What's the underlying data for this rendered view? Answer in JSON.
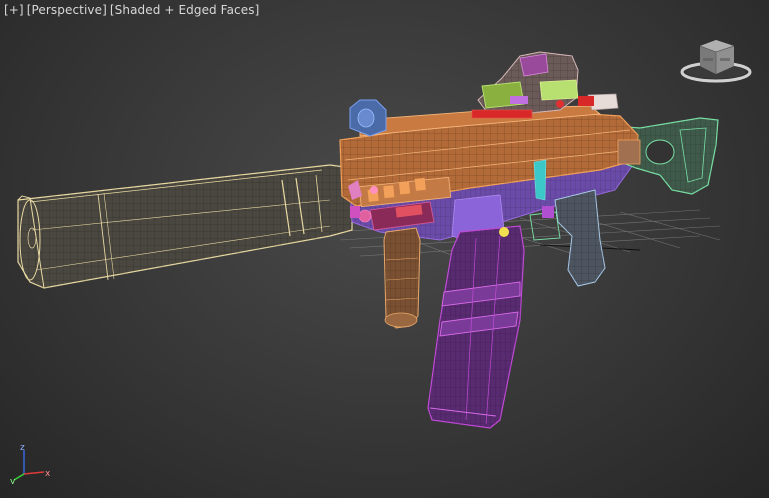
{
  "viewport": {
    "menu_label": "[+]",
    "view_label": "[Perspective]",
    "shading_label": "[Shaded + Edged Faces]"
  },
  "viewcube": {
    "icon": "viewcube-icon"
  },
  "axis_tripod": {
    "x_label": "x",
    "y_label": "y",
    "z_label": "z",
    "colors": {
      "x": "#e23a3a",
      "y": "#3ad43a",
      "z": "#3a6ae8"
    }
  },
  "scene": {
    "object": "smg-wireframe-model",
    "colors": {
      "silencer": "#e8d9a2",
      "receiver": "#f2a05a",
      "sight": "#d8b8b8",
      "stock": "#79e0a5",
      "magazine": "#c04bd6",
      "grip": "#a8c8e8",
      "foregrip": "#e8a86a",
      "lower": "#9a6be0",
      "grid": "#8a8a8a"
    }
  }
}
